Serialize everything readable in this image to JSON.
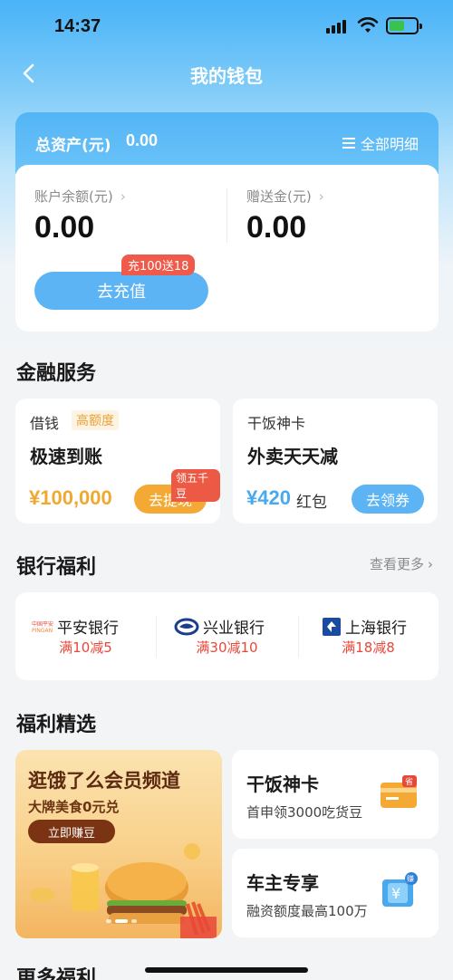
{
  "status_bar": {
    "time": "14:37"
  },
  "nav": {
    "title": "我的钱包"
  },
  "assets": {
    "total_label": "总资产(元)",
    "total_value": "0.00",
    "detail_link": "全部明细",
    "balance_label": "账户余额(元)",
    "balance_value": "0.00",
    "gift_label": "赠送金(元)",
    "gift_value": "0.00",
    "recharge_button": "去充值",
    "recharge_promo": "充100送18"
  },
  "finance": {
    "title": "金融服务",
    "loan": {
      "small": "借钱",
      "badge": "高额度",
      "big": "极速到账",
      "amount": "¥100,000",
      "button": "去提现",
      "tag": "领五千豆"
    },
    "card": {
      "small": "干饭神卡",
      "big": "外卖天天减",
      "amount": "¥420",
      "unit": "红包",
      "button": "去领券"
    }
  },
  "bank_benefits": {
    "title": "银行福利",
    "more": "查看更多",
    "banks": [
      {
        "name": "平安银行",
        "offer": "满10减5",
        "icon": "pingan-logo-icon"
      },
      {
        "name": "兴业银行",
        "offer": "满30减10",
        "icon": "cib-logo-icon"
      },
      {
        "name": "上海银行",
        "offer": "满18减8",
        "icon": "bosc-logo-icon"
      }
    ]
  },
  "selected": {
    "title": "福利精选",
    "banner": {
      "title": "逛饿了么会员频道",
      "subtitle": "大牌美食0元兑",
      "button": "立即赚豆"
    },
    "cards": [
      {
        "title": "干饭神卡",
        "subtitle": "首申领3000吃货豆",
        "badge": "省"
      },
      {
        "title": "车主专享",
        "subtitle": "融资额度最高100万",
        "badge": "赚"
      }
    ]
  },
  "more": {
    "title": "更多福利"
  },
  "colors": {
    "accent_blue": "#5cb4f4",
    "orange": "#f5a935",
    "red": "#e8483a"
  }
}
